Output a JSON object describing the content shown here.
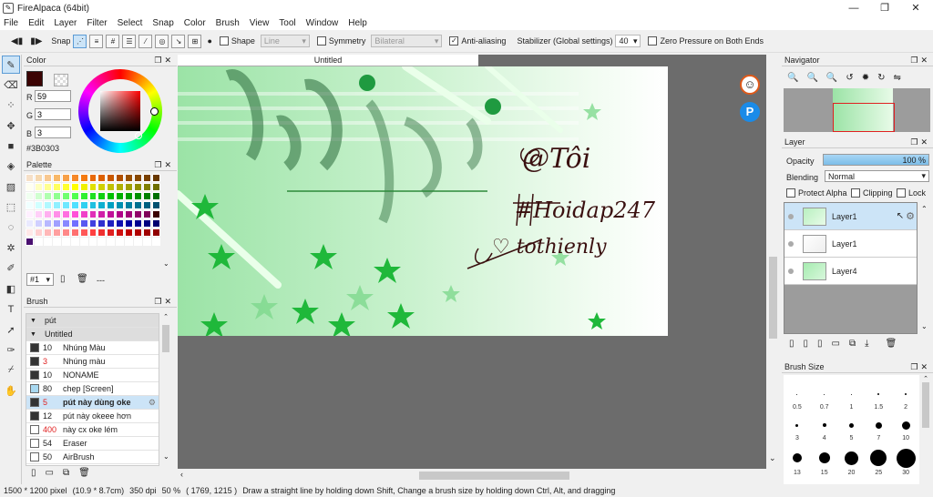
{
  "window": {
    "title": "FireAlpaca (64bit)",
    "controls": [
      "—",
      "❐",
      "✕"
    ]
  },
  "menu": [
    "File",
    "Edit",
    "Layer",
    "Filter",
    "Select",
    "Snap",
    "Color",
    "Brush",
    "View",
    "Tool",
    "Window",
    "Help"
  ],
  "toolbar": {
    "snap_label": "Snap",
    "shape_label": "Shape",
    "shape_value": "Line",
    "symmetry_label": "Symmetry",
    "symmetry_value": "Bilateral",
    "antialias_label": "Anti-aliasing",
    "stabilizer_label": "Stabilizer (Global settings)",
    "stabilizer_value": "40",
    "zero_pressure_label": "Zero Pressure on Both Ends"
  },
  "color_panel": {
    "title": "Color",
    "r_label": "R",
    "r_value": "59",
    "g_label": "G",
    "g_value": "3",
    "b_label": "B",
    "b_value": "3",
    "hex": "#3B0303",
    "current_color": "#3b0303"
  },
  "palette_panel": {
    "title": "Palette",
    "palette_id": "#1",
    "more": "---"
  },
  "brush_panel": {
    "title": "Brush",
    "groups": [
      "pút",
      "Untitled"
    ],
    "items": [
      {
        "size": "10",
        "name": "Nhúng Màu",
        "red": false
      },
      {
        "size": "3",
        "name": "Nhúng màu",
        "red": true
      },
      {
        "size": "10",
        "name": "NONAME",
        "red": false
      },
      {
        "size": "80",
        "name": "chẹp [Screen]",
        "red": false
      },
      {
        "size": "5",
        "name": "pút này dùng oke",
        "red": true,
        "selected": true
      },
      {
        "size": "12",
        "name": "pút này okeee hơn",
        "red": false
      },
      {
        "size": "400",
        "name": "này cx oke lém",
        "red": true
      },
      {
        "size": "54",
        "name": "Eraser",
        "red": false
      },
      {
        "size": "50",
        "name": "AirBrush",
        "red": false
      }
    ]
  },
  "document": {
    "tab": "Untitled"
  },
  "navigator_panel": {
    "title": "Navigator"
  },
  "layer_panel": {
    "title": "Layer",
    "opacity_label": "Opacity",
    "opacity_value": "100 %",
    "opacity_fraction": 1.0,
    "blending_label": "Blending",
    "blending_value": "Normal",
    "protect_alpha": "Protect Alpha",
    "clipping": "Clipping",
    "lock": "Lock",
    "layers": [
      {
        "name": "Layer1",
        "selected": true
      },
      {
        "name": "Layer1",
        "selected": false
      },
      {
        "name": "Layer4",
        "selected": false
      }
    ]
  },
  "brush_size_panel": {
    "title": "Brush Size",
    "rows": [
      [
        "0.5",
        "0.7",
        "1",
        "1.5",
        "2"
      ],
      [
        "3",
        "4",
        "5",
        "7",
        "10"
      ],
      [
        "13",
        "15",
        "20",
        "25",
        "30"
      ]
    ]
  },
  "status": {
    "size": "1500 * 1200 pixel",
    "cm": "(10.9 * 8.7cm)",
    "dpi": "350 dpi",
    "zoom": "50 %",
    "coords": "( 1769, 1215 )",
    "hint": "Draw a straight line by holding down Shift, Change a brush size by holding down Ctrl, Alt, and dragging"
  },
  "artwork": {
    "handwriting": [
      "@Tôi",
      "#Hoidap247",
      "♡ tothienly"
    ]
  }
}
